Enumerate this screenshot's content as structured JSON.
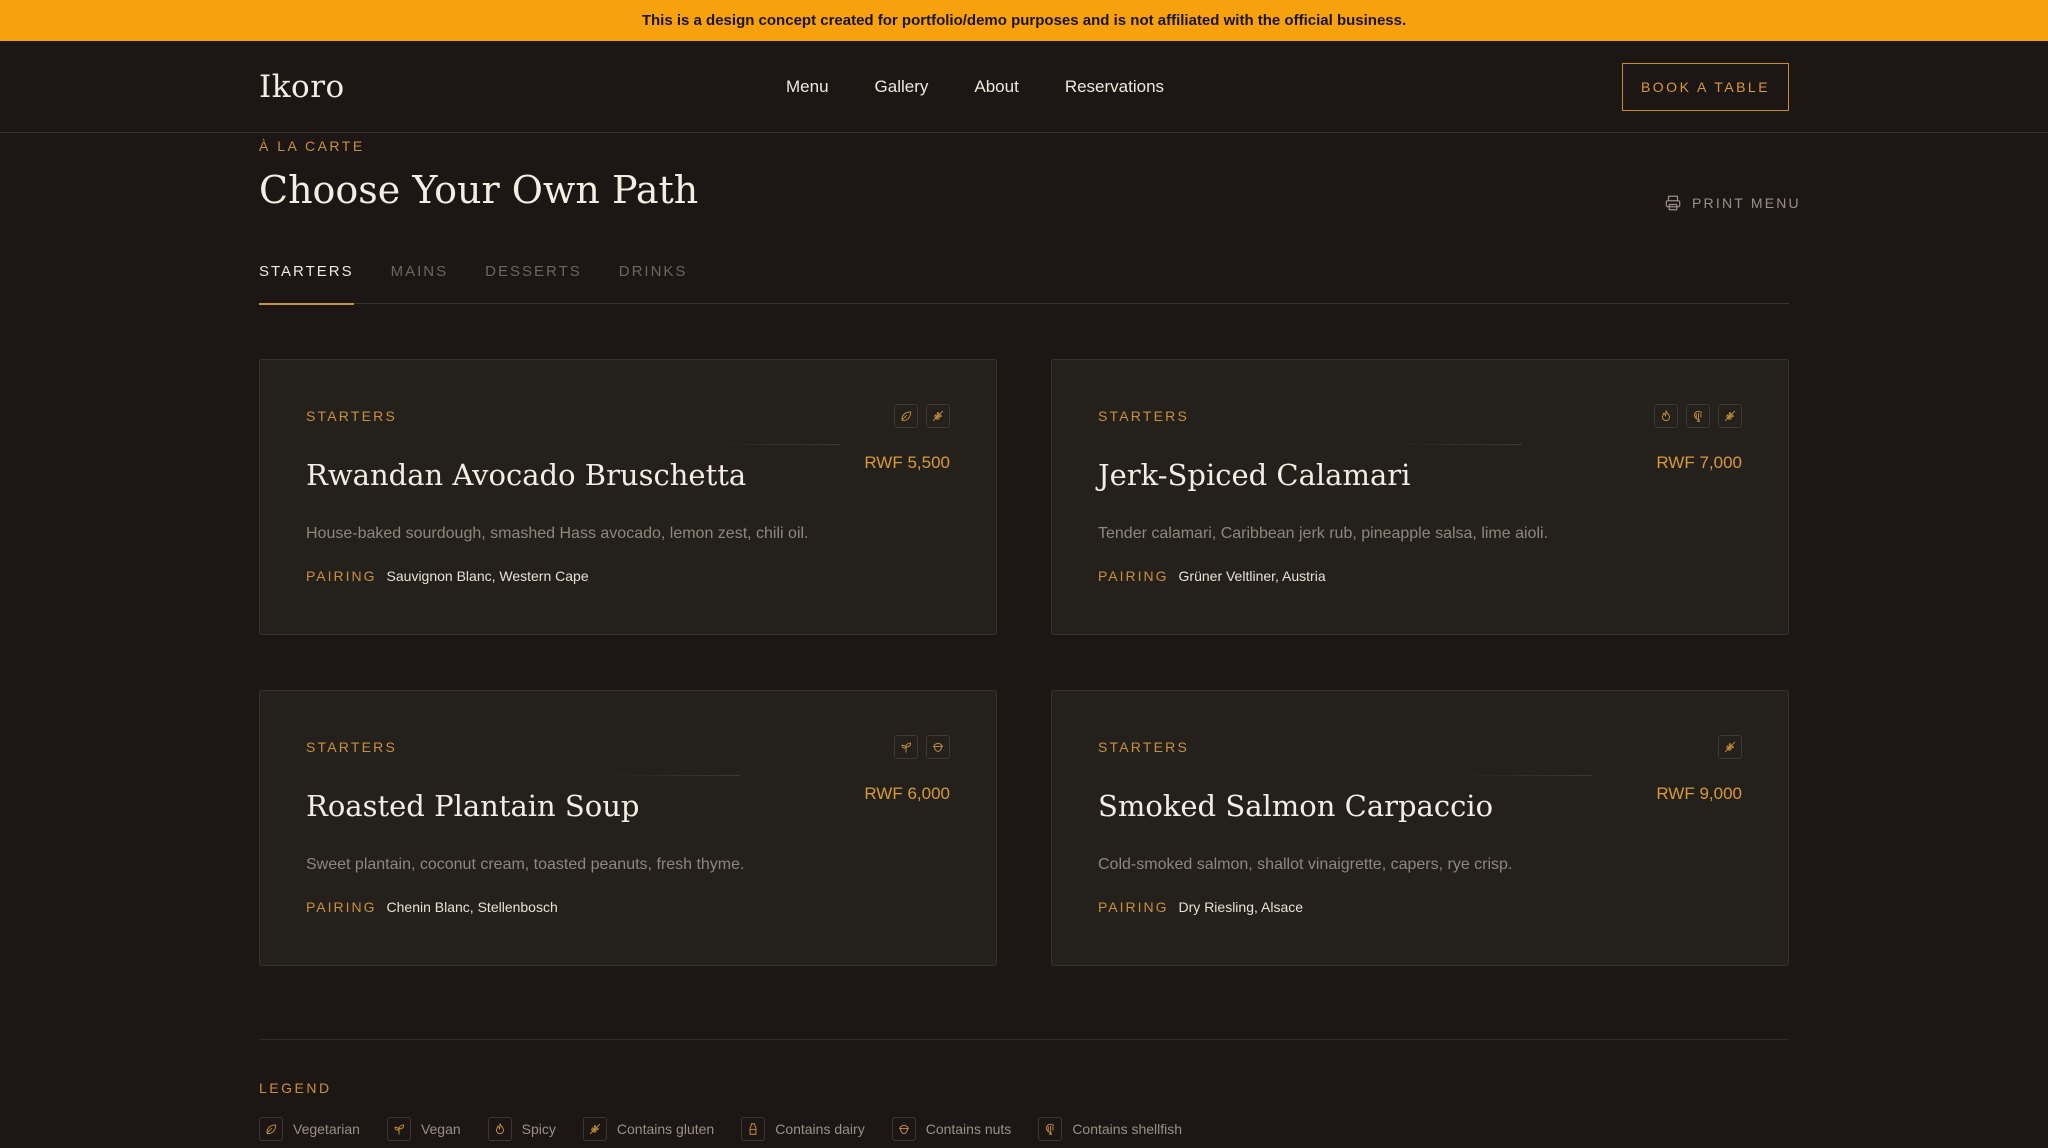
{
  "banner": {
    "text": "This is a design concept created for portfolio/demo purposes and is not affiliated with the official business."
  },
  "header": {
    "logo": "Ikoro",
    "nav": [
      "Menu",
      "Gallery",
      "About",
      "Reservations"
    ],
    "book_label": "BOOK A TABLE"
  },
  "section": {
    "eyebrow": "À LA CARTE",
    "title": "Choose Your Own Path",
    "print_label": "PRINT MENU"
  },
  "tabs": [
    {
      "label": "STARTERS",
      "active": true
    },
    {
      "label": "MAINS",
      "active": false
    },
    {
      "label": "DESSERTS",
      "active": false
    },
    {
      "label": "DRINKS",
      "active": false
    }
  ],
  "pairing_label": "PAIRING",
  "cards": [
    {
      "category": "STARTERS",
      "title": "Rwandan Avocado Bruschetta",
      "price": "RWF 5,500",
      "description": "House-baked sourdough, smashed Hass avocado, lemon zest, chili oil.",
      "pairing": "Sauvignon Blanc, Western Cape",
      "icons": [
        "leaf-icon",
        "wheat-icon"
      ]
    },
    {
      "category": "STARTERS",
      "title": "Jerk-Spiced Calamari",
      "price": "RWF 7,000",
      "description": "Tender calamari, Caribbean jerk rub, pineapple salsa, lime aioli.",
      "pairing": "Grüner Veltliner, Austria",
      "icons": [
        "flame-icon",
        "shrimp-icon",
        "wheat-icon"
      ]
    },
    {
      "category": "STARTERS",
      "title": "Roasted Plantain Soup",
      "price": "RWF 6,000",
      "description": "Sweet plantain, coconut cream, toasted peanuts, fresh thyme.",
      "pairing": "Chenin Blanc, Stellenbosch",
      "icons": [
        "sprout-icon",
        "nut-icon"
      ]
    },
    {
      "category": "STARTERS",
      "title": "Smoked Salmon Carpaccio",
      "price": "RWF 9,000",
      "description": "Cold-smoked salmon, shallot vinaigrette, capers, rye crisp.",
      "pairing": "Dry Riesling, Alsace",
      "icons": [
        "wheat-icon"
      ]
    }
  ],
  "legend": {
    "title": "LEGEND",
    "items": [
      {
        "icon": "leaf-icon",
        "label": "Vegetarian"
      },
      {
        "icon": "sprout-icon",
        "label": "Vegan"
      },
      {
        "icon": "flame-icon",
        "label": "Spicy"
      },
      {
        "icon": "wheat-icon",
        "label": "Contains gluten"
      },
      {
        "icon": "milk-icon",
        "label": "Contains dairy"
      },
      {
        "icon": "nut-icon",
        "label": "Contains nuts"
      },
      {
        "icon": "shrimp-icon",
        "label": "Contains shellfish"
      }
    ]
  },
  "colors": {
    "accent": "#c8913e",
    "banner": "#f7a10f",
    "background": "#1c1614",
    "card": "#24201c"
  }
}
